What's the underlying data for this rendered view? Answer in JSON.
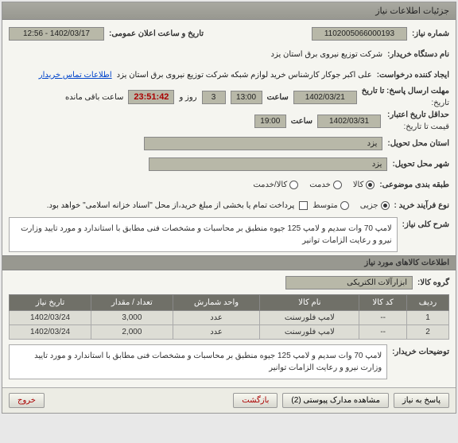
{
  "window_title": "جزئیات اطلاعات نیاز",
  "fields": {
    "need_number_label": "شماره نیاز:",
    "need_number": "1102005066000193",
    "announce_label": "تاریخ و ساعت اعلان عمومی:",
    "announce_value": "1402/03/17 - 12:56",
    "buyer_org_label": "نام دستگاه خریدار:",
    "buyer_org": "شرکت توزیع نیروی برق استان یزد",
    "creator_label": "ایجاد کننده درخواست:",
    "creator": "علی اکبر  جوکار  کارشناس خرید لوازم شبکه  شرکت توزیع نیروی برق استان یزد",
    "contact_link": "اطلاعات تماس خریدار",
    "deadline_send_label": "حداقل تاریخ اعتبار:",
    "deadline_send_sub": "مهلت ارسال پاسخ: تا تاریخ",
    "deadline_date": "1402/03/21",
    "deadline_time_label": "ساعت",
    "deadline_time": "13:00",
    "days_label": "روز و",
    "days_value": "3",
    "countdown": "23:51:42",
    "remain_label": "ساعت باقی مانده",
    "price_valid_label": "قیمت تا تاریخ:",
    "price_valid_date": "1402/03/31",
    "price_valid_time": "19:00",
    "deliver_city_label": "استان محل تحویل:",
    "deliver_city": "یزد",
    "city_label": "شهر محل تحویل:",
    "city": "یزد",
    "need_kind_label": "طبقه بندی موضوعی:",
    "process_label": "نوع فرآیند خرید :",
    "payment_note": "پرداخت تمام یا بخشی از مبلغ خرید،از محل \"اسناد خزانه اسلامی\" خواهد بود.",
    "summary_label": "شرح کلی نیاز:",
    "summary_text": "لامپ 70 وات سدیم و لامپ 125 جیوه منطبق بر  محاسبات و مشخصات فنی مطابق با استاندارد و مورد تایید وزارت نیرو و رعایت الزامات توانیر",
    "items_header": "اطلاعات کالاهای مورد نیاز",
    "group_label": "گروه کالا:",
    "group_value": "ابزارآلات الکتریکی",
    "buyer_desc_label": "توضیحات خریدار:",
    "buyer_desc": "لامپ 70 وات سدیم و لامپ 125 جیوه منطبق بر  محاسبات و مشخصات فنی مطابق با استاندارد و مورد تایید وزارت نیرو و رعایت الزامات توانیر"
  },
  "need_kind_options": [
    {
      "label": "کالا",
      "checked": true
    },
    {
      "label": "خدمت",
      "checked": false
    },
    {
      "label": "کالا/خدمت",
      "checked": false
    }
  ],
  "process_options": [
    {
      "label": "جزیی",
      "checked": true
    },
    {
      "label": "متوسط",
      "checked": false
    }
  ],
  "table": {
    "headers": [
      "ردیف",
      "کد کالا",
      "نام کالا",
      "واحد شمارش",
      "تعداد / مقدار",
      "تاریخ نیاز"
    ],
    "rows": [
      [
        "1",
        "--",
        "لامپ فلورسنت",
        "عدد",
        "3,000",
        "1402/03/24"
      ],
      [
        "2",
        "--",
        "لامپ فلورسنت",
        "عدد",
        "2,000",
        "1402/03/24"
      ]
    ]
  },
  "buttons": {
    "reply": "پاسخ به نیاز",
    "attachments": "مشاهده مدارک پیوستی (2)",
    "back": "بازگشت",
    "exit": "خروج"
  }
}
